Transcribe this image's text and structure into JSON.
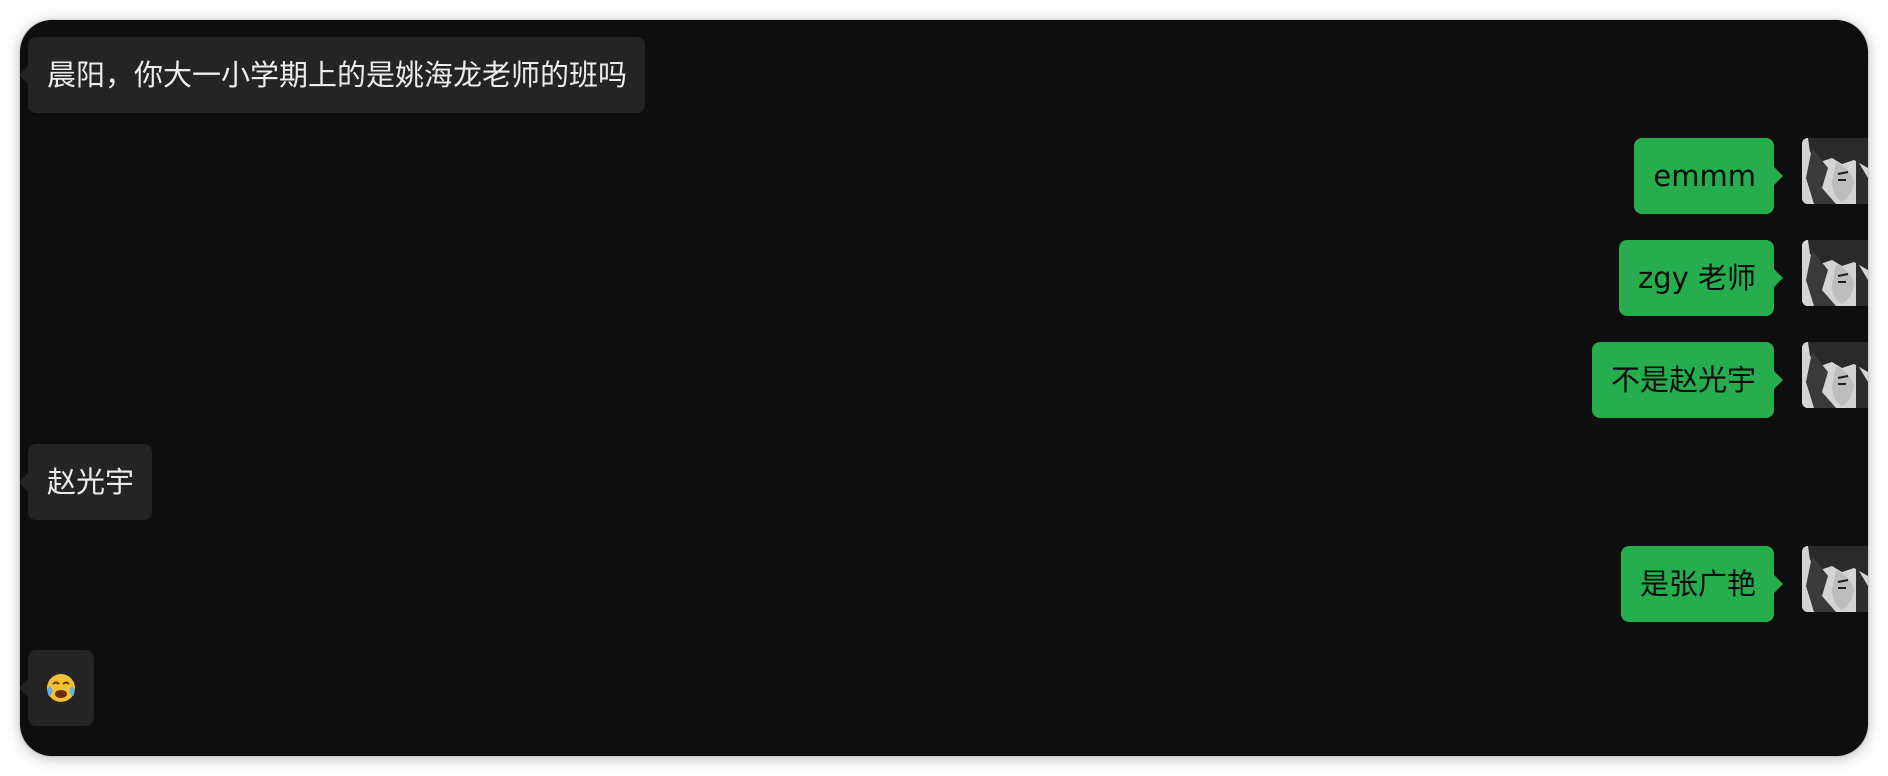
{
  "colors": {
    "background": "#0e0e0e",
    "incoming_bubble": "#242424",
    "outgoing_bubble": "#26ad4d"
  },
  "messages": [
    {
      "direction": "incoming",
      "text": "晨阳，你大一小学期上的是姚海龙老师的班吗"
    },
    {
      "direction": "outgoing",
      "text": "emmm",
      "avatar": "manga-portrait-avatar"
    },
    {
      "direction": "outgoing",
      "text": "zgy 老师",
      "avatar": "manga-portrait-avatar"
    },
    {
      "direction": "outgoing",
      "text": "不是赵光宇",
      "avatar": "manga-portrait-avatar"
    },
    {
      "direction": "incoming",
      "text": "赵光宇"
    },
    {
      "direction": "outgoing",
      "text": "是张广艳",
      "avatar": "manga-portrait-avatar"
    },
    {
      "direction": "incoming",
      "text": "😭",
      "icon": "crying-face-emoji"
    }
  ]
}
